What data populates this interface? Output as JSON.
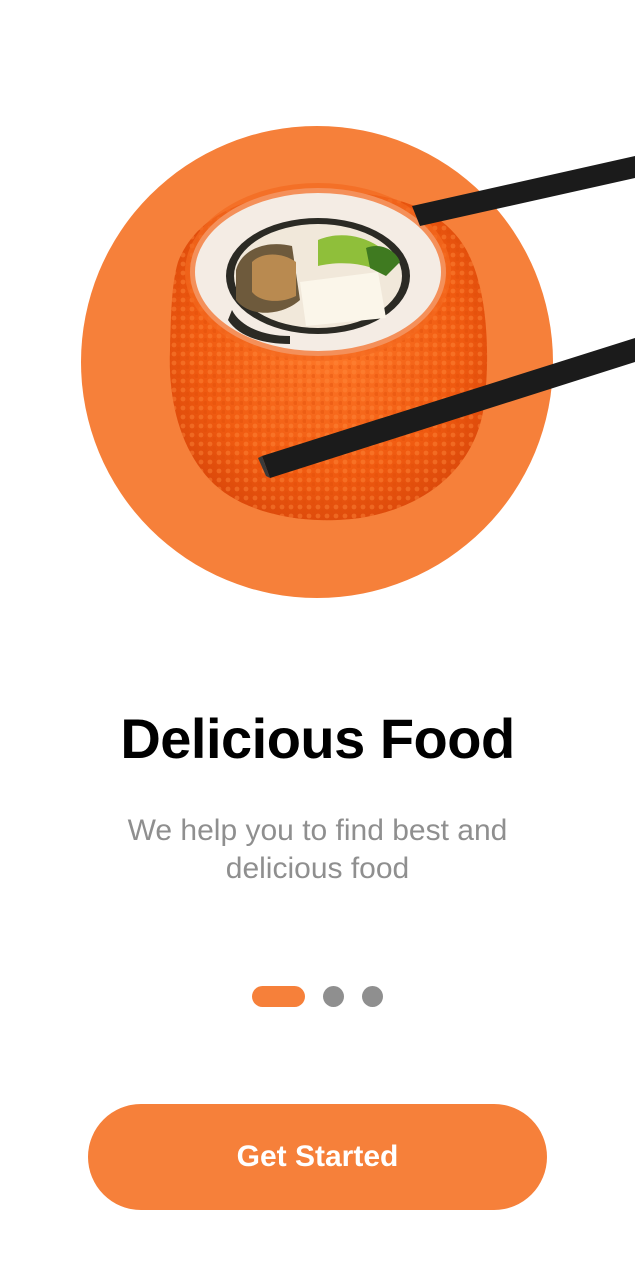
{
  "colors": {
    "accent": "#f6803a",
    "title": "#000000",
    "subtitle": "#8f8f8f",
    "dot_inactive": "#8f8f8f",
    "button_text": "#ffffff"
  },
  "hero": {
    "image": "sushi-roll-with-chopsticks"
  },
  "onboarding": {
    "title": "Delicious Food",
    "subtitle": "We help you to find best and delicious food"
  },
  "pagination": {
    "current_page": 1,
    "total_pages": 3
  },
  "cta": {
    "label": "Get Started"
  }
}
